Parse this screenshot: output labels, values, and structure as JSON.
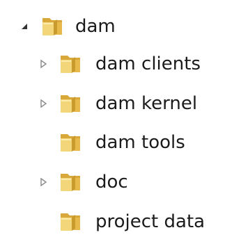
{
  "tree": {
    "root": {
      "label": "dam",
      "expanded": true,
      "icon": "folder-icon",
      "expander_icon": "expanded-triangle-icon"
    },
    "children": [
      {
        "label": "dam clients",
        "has_children": true,
        "icon": "folder-icon",
        "expander_icon": "collapsed-triangle-icon"
      },
      {
        "label": "dam kernel",
        "has_children": true,
        "icon": "folder-icon",
        "expander_icon": "collapsed-triangle-icon"
      },
      {
        "label": "dam tools",
        "has_children": false,
        "icon": "folder-icon"
      },
      {
        "label": "doc",
        "has_children": true,
        "icon": "folder-icon",
        "expander_icon": "collapsed-triangle-icon"
      },
      {
        "label": "project data",
        "has_children": false,
        "icon": "folder-icon"
      }
    ]
  },
  "colors": {
    "folder_front": "#F3D67A",
    "folder_back": "#E6B94A",
    "folder_shadow": "#C99A2E",
    "folder_highlight": "#FBEAA8",
    "expanded_arrow": "#333333",
    "collapsed_arrow": "#8a8a8a"
  }
}
